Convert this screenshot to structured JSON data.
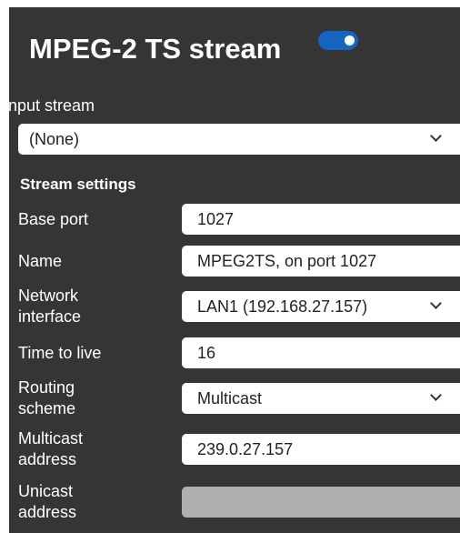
{
  "header": {
    "title": "MPEG-2 TS stream",
    "enabled": true
  },
  "input_stream": {
    "label": "Input stream",
    "value": "(None)"
  },
  "stream_settings": {
    "title": "Stream settings",
    "base_port": {
      "label": "Base port",
      "value": "1027"
    },
    "name": {
      "label": "Name",
      "value": "MPEG2TS, on port 1027"
    },
    "network_interface": {
      "label_line1": "Network",
      "label_line2": "interface",
      "value": "LAN1 (192.168.27.157)"
    },
    "time_to_live": {
      "label": "Time to live",
      "value": "16"
    },
    "routing_scheme": {
      "label_line1": "Routing",
      "label_line2": "scheme",
      "value": "Multicast"
    },
    "multicast_address": {
      "label_line1": "Multicast",
      "label_line2": "address",
      "value": "239.0.27.157"
    },
    "unicast_address": {
      "label_line1": "Unicast",
      "label_line2": "address",
      "value": ""
    }
  },
  "colors": {
    "panel_bg": "#353535",
    "toggle_on": "#1565c0",
    "disabled_field": "#b0b0b0"
  }
}
